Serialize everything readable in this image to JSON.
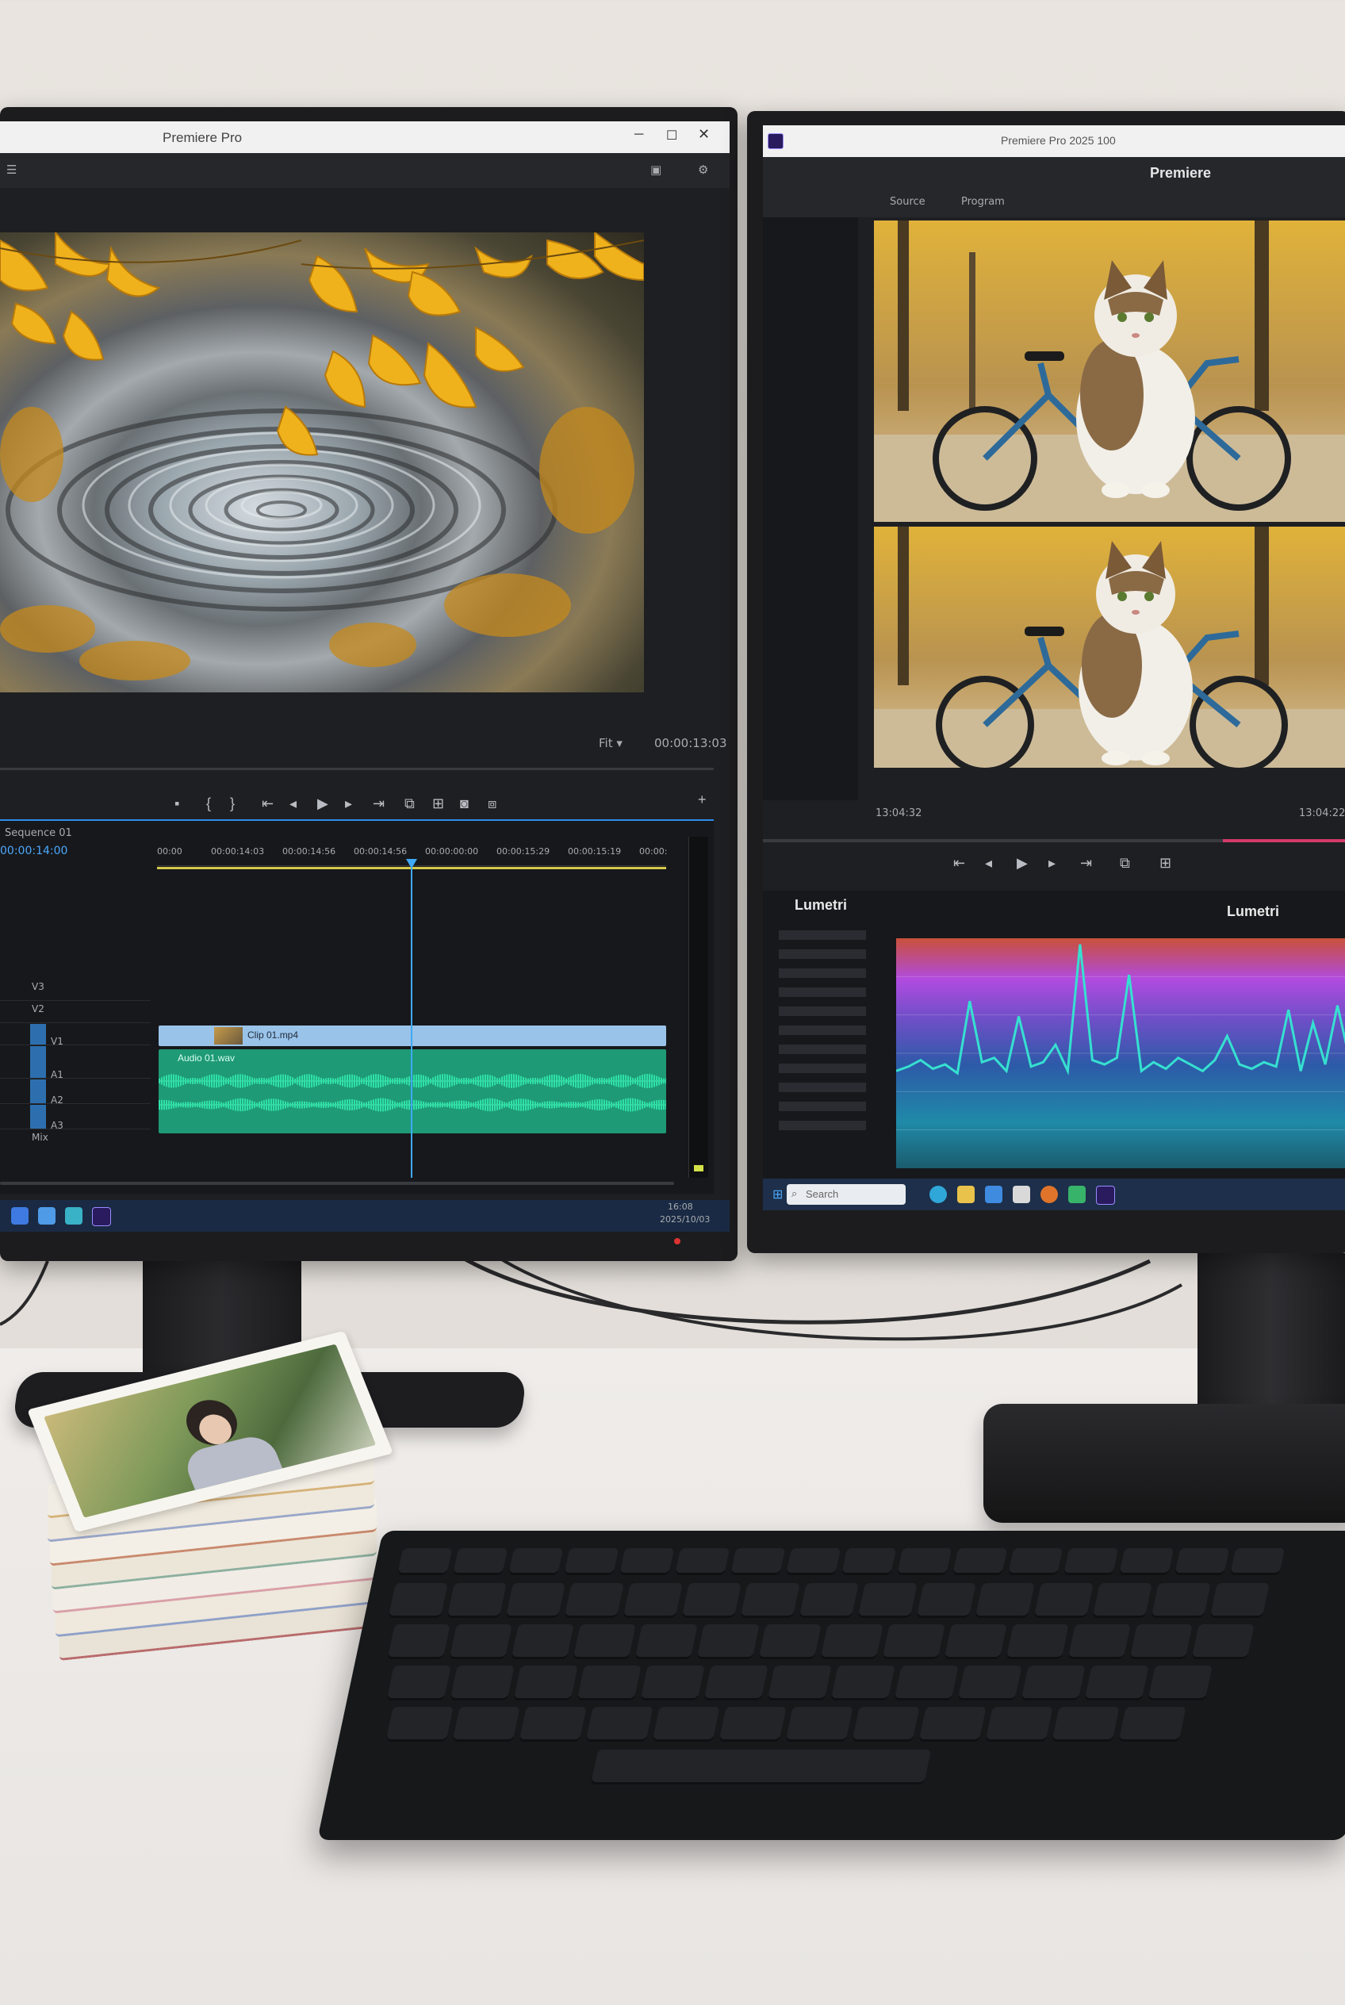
{
  "left_monitor": {
    "window_title": "Premiere Pro",
    "monitor_timecode": "00:00:13:03",
    "fit_label": "Fit",
    "sequence_tab": "Sequence 01",
    "sequence_timecode": "00:00:14:00",
    "ruler_marks": [
      "00:00",
      "00:00:14:03",
      "00:00:14:56",
      "00:00:14:56",
      "00:00:00:00",
      "00:00:15:29",
      "00:00:15:19",
      "00:00:"
    ],
    "track_labels": [
      "V3",
      "V2",
      "V1",
      "A1",
      "A2",
      "A3",
      "Mix"
    ],
    "clip_label": "Clip 01.mp4",
    "audio_clip_label": "Audio 01.wav",
    "tray_time": "16:08",
    "tray_date": "2025/10/03",
    "colors": {
      "accent": "#2d8ceb",
      "audio_clip": "#2fc48f",
      "video_clip": "#9ac3e9",
      "playhead": "#3fa9f5"
    }
  },
  "right_monitor": {
    "window_title": "Premiere Pro 2025 100",
    "app_name": "Premiere",
    "tab_source": "Source",
    "tab_program": "Program",
    "timecode_left": "13:04:32",
    "timecode_right": "13:04:22",
    "lumetri_title": "Lumetri",
    "lumetri_scope_label": "Lumetri",
    "search_placeholder": "Search",
    "colors": {
      "accent": "#3fa9f5",
      "scope_line": "#36e0d0",
      "scope_top": "#b04be0",
      "scope_bottom": "#1f8aa8"
    }
  },
  "waveform_data": [
    0.3,
    0.32,
    0.35,
    0.31,
    0.33,
    0.29,
    0.62,
    0.34,
    0.36,
    0.3,
    0.55,
    0.32,
    0.34,
    0.42,
    0.3,
    0.88,
    0.35,
    0.33,
    0.36,
    0.74,
    0.3,
    0.34,
    0.31,
    0.36,
    0.33,
    0.3,
    0.35,
    0.46,
    0.33,
    0.31,
    0.34,
    0.32,
    0.58,
    0.3,
    0.52,
    0.33,
    0.6,
    0.35
  ]
}
